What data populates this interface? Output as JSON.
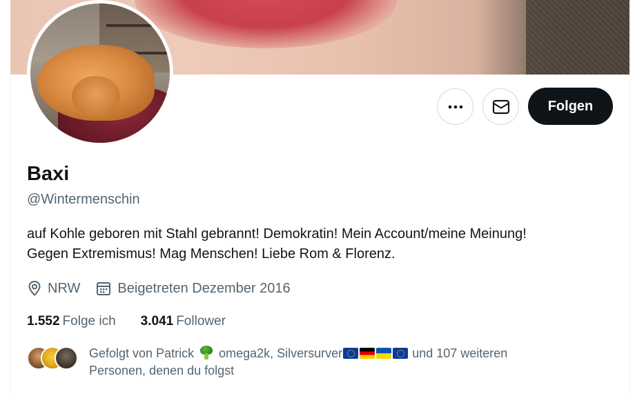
{
  "profile": {
    "name": "Baxi",
    "handle": "@Wintermenschin",
    "bio_line1": "auf Kohle geboren mit Stahl gebrannt! Demokratin! Mein Account/meine Meinung!",
    "bio_line2": "Gegen Extremismus! Mag Menschen! Liebe Rom & Florenz.",
    "location": "NRW",
    "joined": "Beigetreten Dezember 2016"
  },
  "actions": {
    "more_icon": "more-horizontal-icon",
    "message_icon": "mail-icon",
    "follow_label": "Folgen"
  },
  "stats": {
    "following_count": "1.552",
    "following_label": "Folge ich",
    "followers_count": "3.041",
    "followers_label": "Follower"
  },
  "followed_by": {
    "prefix": "Gefolgt von Patrick",
    "mid": "omega2k, Silversurver",
    "suffix": "und 107 weiteren",
    "line2": "Personen, denen du folgst",
    "emoji_broccoli": "broccoli-emoji",
    "flags": [
      "eu-flag",
      "germany-flag",
      "ukraine-flag",
      "eu-flag"
    ]
  },
  "colors": {
    "text_primary": "#0f1419",
    "text_secondary": "#536471",
    "follow_button_bg": "#0f1419",
    "border": "#cfd9de"
  }
}
